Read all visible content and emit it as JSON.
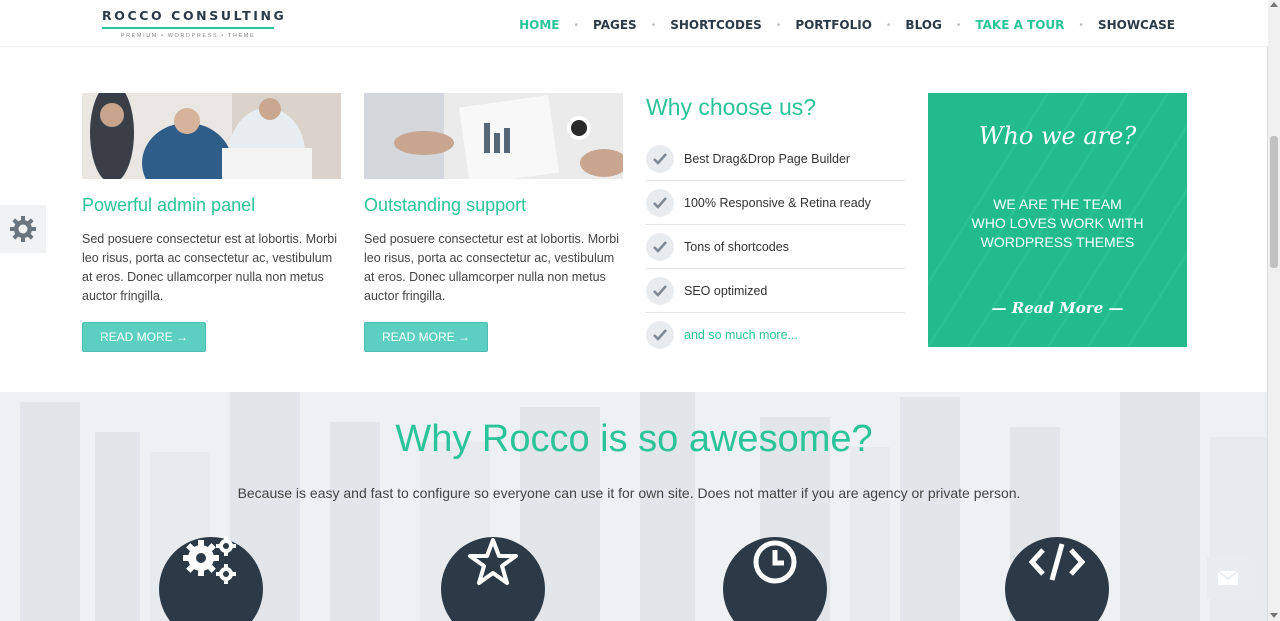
{
  "brand": {
    "name": "ROCCO CONSULTING",
    "tagline": "PREMIUM • WORDPRESS • THEME"
  },
  "nav": {
    "items": [
      {
        "label": "HOME",
        "active": true
      },
      {
        "label": "PAGES"
      },
      {
        "label": "SHORTCODES"
      },
      {
        "label": "PORTFOLIO"
      },
      {
        "label": "BLOG"
      },
      {
        "label": "TAKE A TOUR",
        "highlight": true
      },
      {
        "label": "SHOWCASE"
      }
    ],
    "separator": "•"
  },
  "features": [
    {
      "title": "Powerful admin panel",
      "text": "Sed posuere consectetur est at lobortis. Morbi leo risus, porta ac consectetur ac, vestibulum at eros. Donec ullamcorper nulla non metus auctor fringilla.",
      "button": "READ MORE →"
    },
    {
      "title": "Outstanding support",
      "text": "Sed posuere consectetur est at lobortis. Morbi leo risus, porta ac consectetur ac, vestibulum at eros. Donec ullamcorper nulla non metus auctor fringilla.",
      "button": "READ MORE →"
    }
  ],
  "why": {
    "title": "Why choose us?",
    "items": [
      "Best Drag&Drop Page Builder",
      "100% Responsive & Retina ready",
      "Tons of shortcodes",
      "SEO optimized",
      "and so much more..."
    ]
  },
  "who": {
    "title": "Who we are?",
    "line1": "WE ARE THE TEAM",
    "line2": "WHO LOVES WORK WITH",
    "line3": "WORDPRESS THEMES",
    "more": "— Read More —"
  },
  "lower": {
    "title": "Why Rocco is so awesome?",
    "text": "Because is easy and fast to configure so everyone can use it for own site. Does not matter if you are agency or private person.",
    "icons": [
      "gears-icon",
      "star-icon",
      "clock-icon",
      "code-icon"
    ]
  },
  "colors": {
    "accent": "#2bc49a",
    "dark": "#2c3a48",
    "button": "#5ccfc1",
    "who_bg": "#22bb8c"
  }
}
